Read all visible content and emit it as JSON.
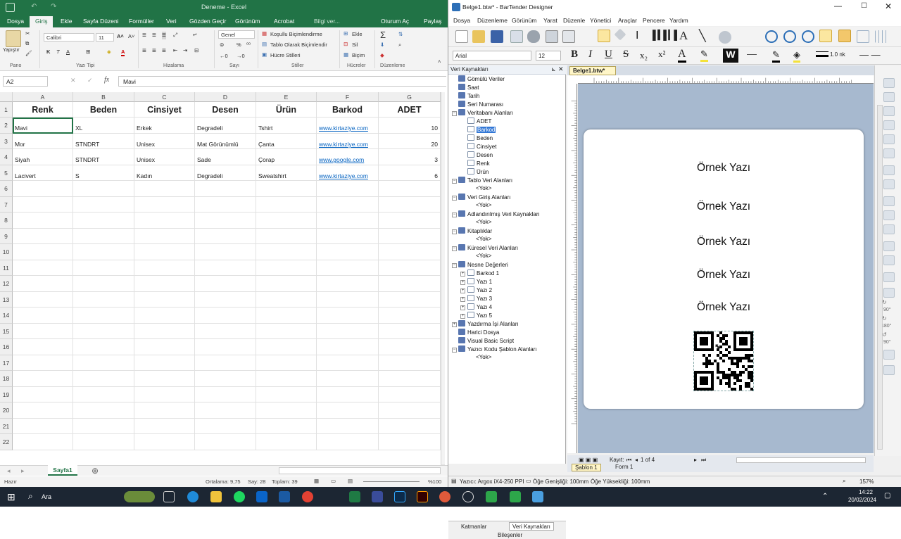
{
  "excel": {
    "title": "Deneme - Excel",
    "tabs": [
      "Dosya",
      "Giriş",
      "Ekle",
      "Sayfa Düzeni",
      "Formüller",
      "Veri",
      "Gözden Geçir",
      "Görünüm",
      "Acrobat",
      "Bilgi ver...",
      "Oturum Aç",
      "Paylaş"
    ],
    "active_tab": "Giriş",
    "ribbon": {
      "font_name": "Calibri",
      "font_size": "11",
      "number_format": "Genel",
      "paste_label": "Yapıştır",
      "conditional_label": "Koşullu Biçimlendirme",
      "table_format_label": "Tablo Olarak Biçimlendir",
      "cell_styles_label": "Hücre Stilleri",
      "insert_label": "Ekle",
      "delete_label": "Sil",
      "format_label": "Biçim",
      "groups": [
        "Pano",
        "Yazı Tipi",
        "Hizalama",
        "Sayı",
        "Stiller",
        "Hücreler",
        "Düzenleme"
      ]
    },
    "name_box": "A2",
    "formula_value": "Mavi",
    "columns": [
      "A",
      "B",
      "C",
      "D",
      "E",
      "F",
      "G"
    ],
    "header_row": [
      "Renk",
      "Beden",
      "Cinsiyet",
      "Desen",
      "Ürün",
      "Barkod",
      "ADET"
    ],
    "rows": [
      [
        "Mavi",
        "XL",
        "Erkek",
        "Degradeli",
        "Tshirt",
        "www.kirtaziye.com",
        "10"
      ],
      [
        "Mor",
        "STNDRT",
        "Unisex",
        "Mat Görünümlü",
        "Çanta",
        "www.kirtaziye.com",
        "20"
      ],
      [
        "Siyah",
        "STNDRT",
        "Unisex",
        "Sade",
        "Çorap",
        "www.google.com",
        "3"
      ],
      [
        "Lacivert",
        "S",
        "Kadın",
        "Degradeli",
        "Sweatshirt",
        "www.kirtaziye.com",
        "6"
      ]
    ],
    "row_numbers": [
      "1",
      "2",
      "3",
      "4",
      "5",
      "6",
      "7",
      "8",
      "9",
      "10",
      "11",
      "12",
      "13",
      "14",
      "15",
      "16",
      "17",
      "18",
      "19",
      "20",
      "21",
      "22"
    ],
    "sheet_tab": "Sayfa1",
    "status": {
      "ready": "Hazır",
      "average": "Ortalama: 9,75",
      "count": "Say: 28",
      "sum": "Toplam: 39",
      "zoom": "%100"
    }
  },
  "bartender": {
    "title": "Belge1.btw* - BarTender Designer",
    "menu": [
      "Dosya",
      "Düzenleme",
      "Görünüm",
      "Yarat",
      "Düzenle",
      "Yönetici",
      "Araçlar",
      "Pencere",
      "Yardım"
    ],
    "font_name": "Arial",
    "font_size": "12",
    "line_width": "1.0 nk",
    "panel_title": "Veri Kaynakları",
    "tree": [
      {
        "label": "Gömülü Veriler",
        "depth": 0,
        "expander": ""
      },
      {
        "label": "Saat",
        "depth": 0,
        "expander": ""
      },
      {
        "label": "Tarih",
        "depth": 0,
        "expander": ""
      },
      {
        "label": "Seri Numarası",
        "depth": 0,
        "expander": ""
      },
      {
        "label": "Veritabanı Alanları",
        "depth": 0,
        "expander": "-"
      },
      {
        "label": "ADET",
        "depth": 1,
        "expander": ""
      },
      {
        "label": "Barkod",
        "depth": 1,
        "expander": "",
        "selected": true
      },
      {
        "label": "Beden",
        "depth": 1,
        "expander": ""
      },
      {
        "label": "Cinsiyet",
        "depth": 1,
        "expander": ""
      },
      {
        "label": "Desen",
        "depth": 1,
        "expander": ""
      },
      {
        "label": "Renk",
        "depth": 1,
        "expander": ""
      },
      {
        "label": "Ürün",
        "depth": 1,
        "expander": ""
      },
      {
        "label": "Tablo Veri Alanları",
        "depth": 0,
        "expander": "-"
      },
      {
        "label": "<Yok>",
        "depth": 2,
        "expander": ""
      },
      {
        "label": "Veri Giriş Alanları",
        "depth": 0,
        "expander": "-"
      },
      {
        "label": "<Yok>",
        "depth": 2,
        "expander": ""
      },
      {
        "label": "Adlandırılmış Veri Kaynakları",
        "depth": 0,
        "expander": "-"
      },
      {
        "label": "<Yok>",
        "depth": 2,
        "expander": ""
      },
      {
        "label": "Kitaplıklar",
        "depth": 0,
        "expander": "-"
      },
      {
        "label": "<Yok>",
        "depth": 2,
        "expander": ""
      },
      {
        "label": "Küresel Veri Alanları",
        "depth": 0,
        "expander": "-"
      },
      {
        "label": "<Yok>",
        "depth": 2,
        "expander": ""
      },
      {
        "label": "Nesne Değerleri",
        "depth": 0,
        "expander": "-"
      },
      {
        "label": "Barkod 1",
        "depth": 1,
        "expander": "+"
      },
      {
        "label": "Yazı 1",
        "depth": 1,
        "expander": "+"
      },
      {
        "label": "Yazı 2",
        "depth": 1,
        "expander": "+"
      },
      {
        "label": "Yazı 3",
        "depth": 1,
        "expander": "+"
      },
      {
        "label": "Yazı 4",
        "depth": 1,
        "expander": "+"
      },
      {
        "label": "Yazı 5",
        "depth": 1,
        "expander": "+"
      },
      {
        "label": "Yazdırma İşi Alanları",
        "depth": 0,
        "expander": "+"
      },
      {
        "label": "Harici Dosya",
        "depth": 0,
        "expander": ""
      },
      {
        "label": "Visual Basic Script",
        "depth": 0,
        "expander": ""
      },
      {
        "label": "Yazıcı Kodu Şablon Alanları",
        "depth": 0,
        "expander": "-"
      },
      {
        "label": "<Yok>",
        "depth": 2,
        "expander": ""
      }
    ],
    "panel_tabs": [
      "Katmanlar",
      "Veri Kaynakları",
      "Bileşenler"
    ],
    "doc_tab": "Belge1.btw*",
    "label_texts": [
      "Örnek Yazı",
      "Örnek Yazı",
      "Örnek Yazı",
      "Örnek Yazı",
      "Örnek Yazı"
    ],
    "record_label": "Kayıt:",
    "record_value": "1 of 4",
    "template_tab": "Şablon 1",
    "form_tab": "Form 1",
    "rotate_labels": [
      "90°",
      "180°",
      "90°"
    ],
    "status": {
      "printer": "Yazıcı: Argox iX4-250 PPI",
      "width": "Öğe Genişliği: 100mm",
      "height": "Öğe Yüksekliği: 100mm",
      "zoom": "157%"
    }
  },
  "taskbar": {
    "search": "Ara",
    "time": "14:22",
    "date": "20/02/2024"
  }
}
